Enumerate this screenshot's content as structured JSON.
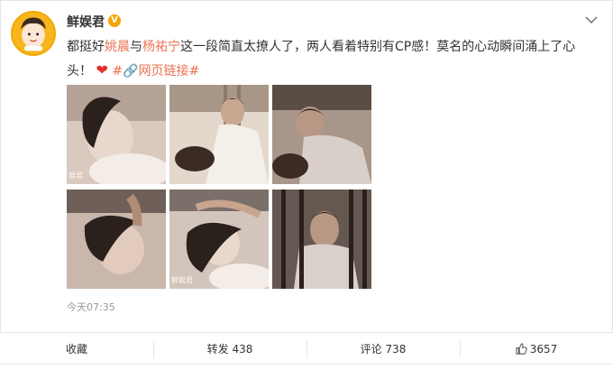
{
  "post": {
    "username": "鲜娱君",
    "verified_badge": "V",
    "text_part1": "都挺好",
    "name1": "姚晨",
    "text_part2": "与",
    "name2": "杨祐宁",
    "text_part3": "这一段简直太撩人了，两人看着特别有CP感！莫名的心动瞬间涌上了心头！",
    "heart": "❤",
    "link_text": "#🔗网页链接#",
    "timestamp": "今天07:35"
  },
  "images": [
    {
      "label": "photo-1",
      "watermark": "娱君",
      "colors": [
        "#8e7a72",
        "#d9c9bf"
      ]
    },
    {
      "label": "photo-2",
      "watermark": "",
      "colors": [
        "#b8a89a",
        "#e4d8cc"
      ]
    },
    {
      "label": "photo-3",
      "watermark": "",
      "colors": [
        "#5a4d44",
        "#a8968a"
      ]
    },
    {
      "label": "photo-4",
      "watermark": "",
      "colors": [
        "#6e6058",
        "#c9b7ab"
      ]
    },
    {
      "label": "photo-5",
      "watermark": "鲜娱君",
      "colors": [
        "#7a6f69",
        "#d2c5bc"
      ]
    },
    {
      "label": "photo-6",
      "watermark": "",
      "colors": [
        "#3c332e",
        "#8c7d72"
      ]
    }
  ],
  "actions": {
    "favorite": "收藏",
    "repost": "转发 438",
    "comment": "评论 738",
    "like": "3657"
  },
  "colors": {
    "highlight": "#eb7350",
    "avatar_bg": "#f7b51e",
    "border": "#e6e6e6"
  }
}
